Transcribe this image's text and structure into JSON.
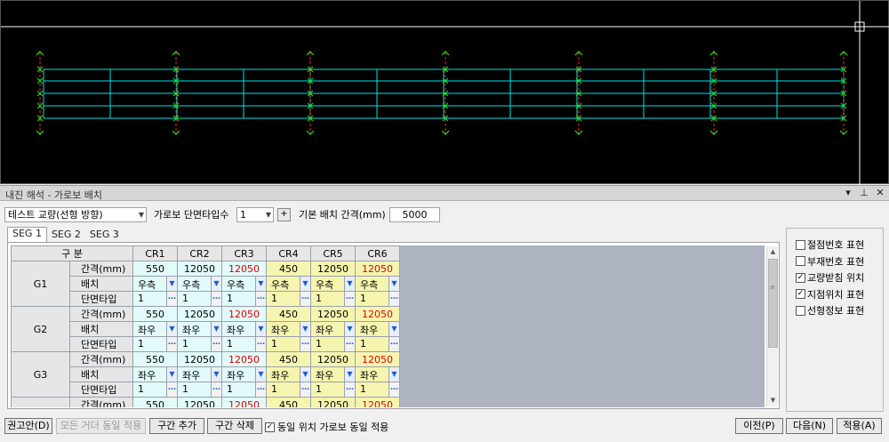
{
  "panel": {
    "title": "내진 해석 - 가로보 배치",
    "ctrl_dropdown": "▾",
    "ctrl_pin": "⊥",
    "ctrl_close": "✕"
  },
  "controls": {
    "bridge_select": "테스트 교량(선형 방향)",
    "section_type_count_label": "가로보 단면타입수",
    "section_type_count": "1",
    "plus_label": "+",
    "spacing_label": "기본 배치 간격(mm)",
    "spacing_value": "5000"
  },
  "tabs": [
    "SEG 1",
    "SEG 2",
    "SEG 3"
  ],
  "grid": {
    "header_label": "구 분",
    "columns": [
      "CR1",
      "CR2",
      "CR3",
      "CR4",
      "CR5",
      "CR6"
    ],
    "column_colors": [
      "cyan",
      "cyan",
      "cyan",
      "yellow",
      "yellow",
      "yellow"
    ],
    "row_labels": {
      "spacing": "간격(mm)",
      "layout": "배치",
      "section": "단면타입"
    },
    "groups": [
      {
        "name": "G1",
        "spacing": [
          "550",
          "12050",
          "12050",
          "450",
          "12050",
          "12050"
        ],
        "spacing_red": [
          false,
          false,
          true,
          false,
          false,
          true
        ],
        "layout": [
          "우측",
          "우측",
          "우측",
          "우측",
          "우측",
          "우측"
        ],
        "section": [
          "1",
          "1",
          "1",
          "1",
          "1",
          "1"
        ]
      },
      {
        "name": "G2",
        "spacing": [
          "550",
          "12050",
          "12050",
          "450",
          "12050",
          "12050"
        ],
        "spacing_red": [
          false,
          false,
          true,
          false,
          false,
          true
        ],
        "layout": [
          "좌우",
          "좌우",
          "좌우",
          "좌우",
          "좌우",
          "좌우"
        ],
        "section": [
          "1",
          "1",
          "1",
          "1",
          "1",
          "1"
        ]
      },
      {
        "name": "G3",
        "spacing": [
          "550",
          "12050",
          "12050",
          "450",
          "12050",
          "12050"
        ],
        "spacing_red": [
          false,
          false,
          true,
          false,
          false,
          true
        ],
        "layout": [
          "좌우",
          "좌우",
          "좌우",
          "좌우",
          "좌우",
          "좌우"
        ],
        "section": [
          "1",
          "1",
          "1",
          "1",
          "1",
          "1"
        ]
      },
      {
        "name": "",
        "spacing": [
          "550",
          "12050",
          "12050",
          "450",
          "12050",
          "12050"
        ],
        "spacing_red": [
          false,
          false,
          true,
          false,
          false,
          true
        ],
        "layout": [],
        "section": []
      }
    ]
  },
  "options": [
    {
      "label": "절점번호 표현",
      "checked": false
    },
    {
      "label": "부재번호 표현",
      "checked": false
    },
    {
      "label": "교량받침 위치",
      "checked": true
    },
    {
      "label": "지점위치 표현",
      "checked": true
    },
    {
      "label": "선형정보 표현",
      "checked": false
    }
  ],
  "buttons": {
    "recommend": "권고안(D)",
    "apply_all_girders": "모든 거더 동일 적용",
    "add_section": "구간 추가",
    "delete_section": "구간 삭제",
    "same_position_label": "동일 위치 가로보 동일 적용",
    "same_position_checked": true,
    "prev": "이전(P)",
    "next": "다음(N)",
    "apply": "적용(A)"
  },
  "colors": {
    "cad_background": "#000000",
    "girder_line": "#00e5e5",
    "support_red": "#ff2020",
    "support_green": "#19e619",
    "cursor_white": "#ffffff"
  }
}
